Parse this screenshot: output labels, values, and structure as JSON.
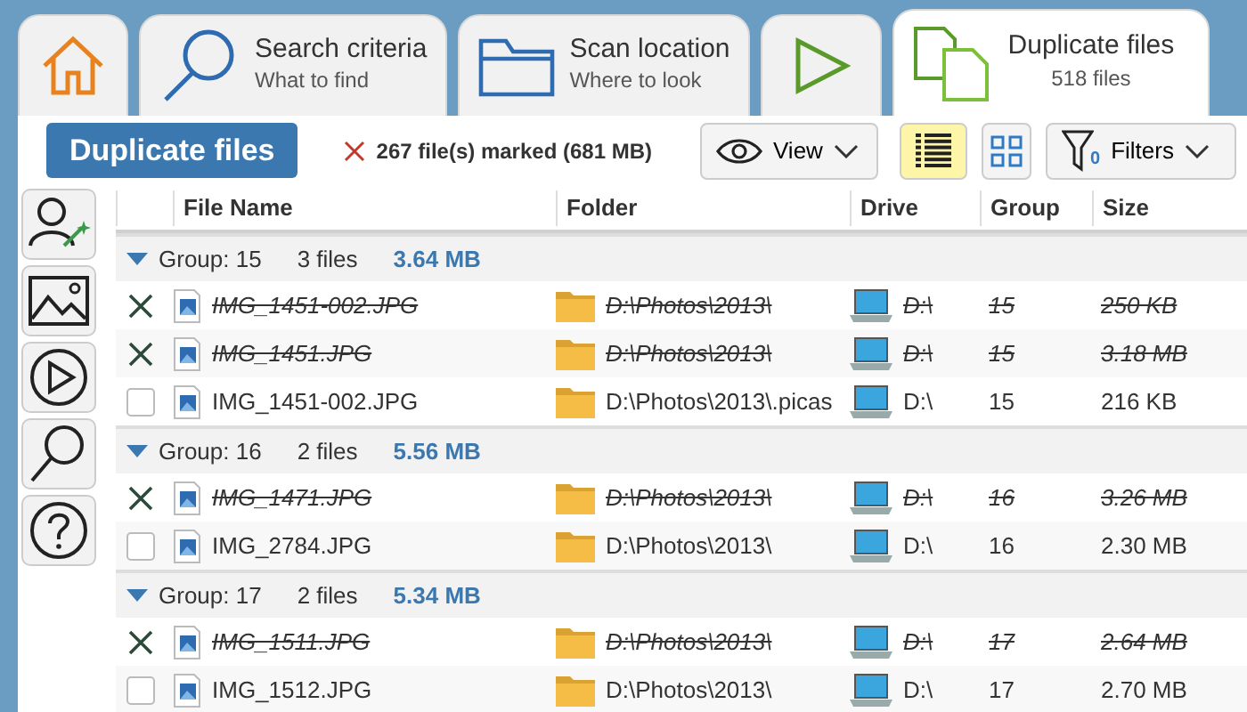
{
  "tabs": [
    {
      "kind": "home",
      "selected": false
    },
    {
      "kind": "search",
      "title": "Search criteria",
      "subtitle": "What to find",
      "selected": false
    },
    {
      "kind": "folder",
      "title": "Scan location",
      "subtitle": "Where to look",
      "selected": false
    },
    {
      "kind": "play",
      "selected": false
    },
    {
      "kind": "duplicates",
      "title": "Duplicate files",
      "subtitle": "518 files",
      "selected": true
    }
  ],
  "toolbar": {
    "title": "Duplicate files",
    "marked": "267 file(s) marked (681 MB)",
    "view": "View",
    "list_view": {
      "selected": true
    },
    "grid_view": {
      "selected": false
    },
    "filters": "Filters",
    "filter_count": "0"
  },
  "sidebar": [
    {
      "kind": "wizard"
    },
    {
      "kind": "image"
    },
    {
      "kind": "play"
    },
    {
      "kind": "search"
    },
    {
      "kind": "help"
    }
  ],
  "table": {
    "columns": [
      "File Name",
      "Folder",
      "Drive",
      "Group",
      "Size"
    ],
    "groups": [
      {
        "label": "Group: 15",
        "count": "3 files",
        "size": "3.64 MB",
        "expanded": true,
        "files": [
          {
            "name": "IMG_1451-002.JPG",
            "folder": "D:\\Photos\\2013\\",
            "drive": "D:\\",
            "group": "15",
            "size": "250 KB",
            "marked": true
          },
          {
            "name": "IMG_1451.JPG",
            "folder": "D:\\Photos\\2013\\",
            "drive": "D:\\",
            "group": "15",
            "size": "3.18 MB",
            "marked": true
          },
          {
            "name": "IMG_1451-002.JPG",
            "folder": "D:\\Photos\\2013\\.picas",
            "drive": "D:\\",
            "group": "15",
            "size": "216 KB",
            "marked": false
          }
        ]
      },
      {
        "label": "Group: 16",
        "count": "2 files",
        "size": "5.56 MB",
        "expanded": true,
        "files": [
          {
            "name": "IMG_1471.JPG",
            "folder": "D:\\Photos\\2013\\",
            "drive": "D:\\",
            "group": "16",
            "size": "3.26 MB",
            "marked": true
          },
          {
            "name": "IMG_2784.JPG",
            "folder": "D:\\Photos\\2013\\",
            "drive": "D:\\",
            "group": "16",
            "size": "2.30 MB",
            "marked": false
          }
        ]
      },
      {
        "label": "Group: 17",
        "count": "2 files",
        "size": "5.34 MB",
        "expanded": true,
        "files": [
          {
            "name": "IMG_1511.JPG",
            "folder": "D:\\Photos\\2013\\",
            "drive": "D:\\",
            "group": "17",
            "size": "2.64 MB",
            "marked": true
          },
          {
            "name": "IMG_1512.JPG",
            "folder": "D:\\Photos\\2013\\",
            "drive": "D:\\",
            "group": "17",
            "size": "2.70 MB",
            "marked": false
          }
        ]
      }
    ]
  }
}
